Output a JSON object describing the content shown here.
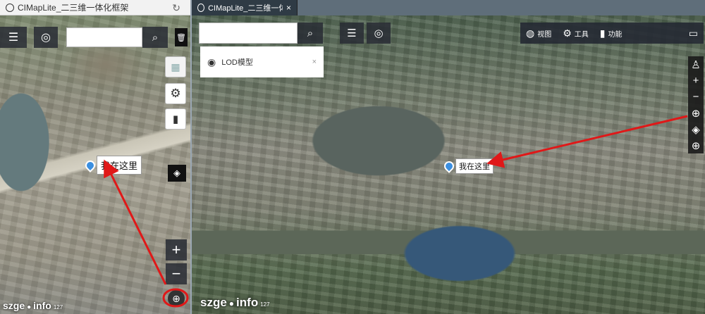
{
  "left_window": {
    "tab_title": "CIMapLite_二三维一体化框架",
    "search": {
      "placeholder": "",
      "value": ""
    },
    "map_label": "我在这里",
    "zoom_in": "+",
    "zoom_out": "−",
    "logo_main": "szge",
    "logo_info": "info",
    "logo_small": "127"
  },
  "right_window": {
    "tab_title": "CIMapLite_二三维一体化...",
    "tab_close": "×",
    "search": {
      "placeholder": "",
      "value": ""
    },
    "toolbar": [
      {
        "icon": "globe-icon",
        "label": "视图"
      },
      {
        "icon": "gear-icon",
        "label": "工具"
      },
      {
        "icon": "bar-chart-icon",
        "label": "功能"
      }
    ],
    "layer_panel": {
      "icon": "eye-icon",
      "label": "LOD模型",
      "close": "×"
    },
    "map_label": "我在这里",
    "vertical_tools": [
      {
        "name": "compass-icon",
        "glyph": "♙"
      },
      {
        "name": "zoom-in-icon",
        "glyph": "+"
      },
      {
        "name": "zoom-out-icon",
        "glyph": "−"
      },
      {
        "name": "locate-icon",
        "glyph": "⊕"
      },
      {
        "name": "layers-icon",
        "glyph": "◈"
      },
      {
        "name": "zoom-extent-icon",
        "glyph": "⊕"
      }
    ],
    "logo_main": "szge",
    "logo_info": "info",
    "logo_small": "127"
  },
  "colors": {
    "annotation_arrow": "#e01818",
    "marker": "#3b8fe0"
  }
}
